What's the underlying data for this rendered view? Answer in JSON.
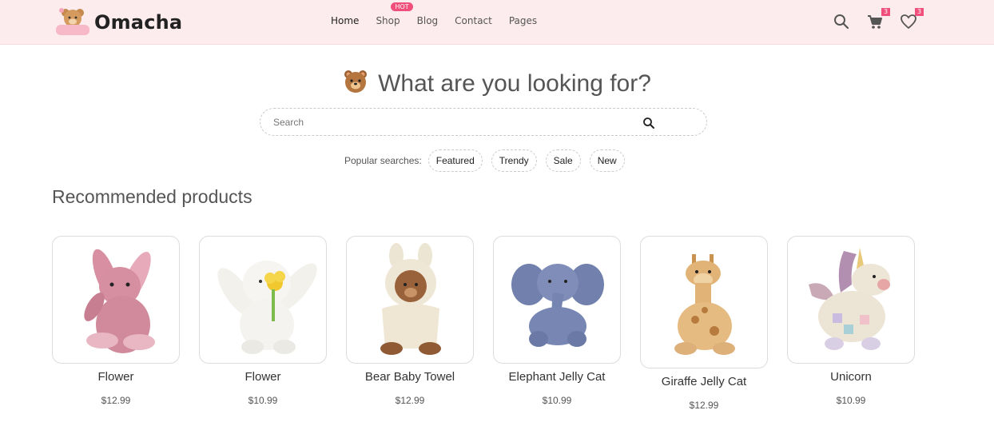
{
  "header": {
    "logo_text": "Omacha",
    "logo_badge_text": "Omacha",
    "nav": [
      {
        "label": "Home",
        "active": true
      },
      {
        "label": "Shop",
        "badge": "HOT"
      },
      {
        "label": "Blog"
      },
      {
        "label": "Contact"
      },
      {
        "label": "Pages"
      }
    ],
    "icons": {
      "search": "search-icon",
      "cart": "cart-icon",
      "wishlist": "heart-icon"
    },
    "cart_count": "3",
    "wishlist_count": "3"
  },
  "search": {
    "title": "What are you looking for?",
    "placeholder": "Search",
    "popular_label": "Popular searches:",
    "chips": [
      "Featured",
      "Trendy",
      "Sale",
      "New"
    ]
  },
  "recommended": {
    "title": "Recommended products",
    "products": [
      {
        "name": "Flower",
        "price": "$12.99"
      },
      {
        "name": "Flower",
        "price": "$10.99"
      },
      {
        "name": "Bear Baby Towel",
        "price": "$12.99"
      },
      {
        "name": "Elephant Jelly Cat",
        "price": "$10.99"
      },
      {
        "name": "Giraffe Jelly Cat",
        "price": "$12.99"
      },
      {
        "name": "Unicorn",
        "price": "$10.99"
      }
    ]
  },
  "colors": {
    "header_bg": "#fdecee",
    "accent": "#ef4f7a"
  }
}
